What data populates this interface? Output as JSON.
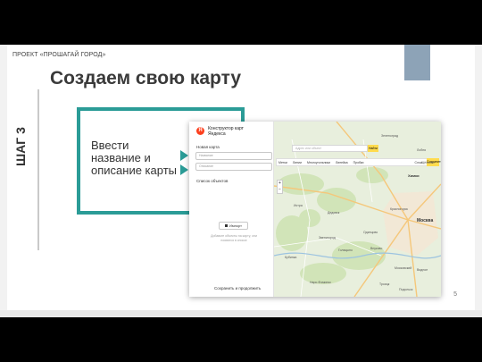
{
  "slide": {
    "project_label": "ПРОЕКТ «ПРОШАГАЙ ГОРОД»",
    "title": "Создаем свою карту",
    "step_label": "ШАГ 3",
    "instruction": "Ввести название и описание карты",
    "page_number": "5"
  },
  "constructor": {
    "brand_line1": "Конструктор карт",
    "brand_line2": "Яндекса",
    "logo_letter": "Я",
    "new_map_label": "Новая карта",
    "name_placeholder": "Название",
    "description_placeholder": "Описание",
    "objects_label": "Список объектов",
    "import_label": "Импорт",
    "hint_text": "Добавьте объекты на карту, они появятся в списке",
    "save_continue": "Сохранить и продолжить"
  },
  "map": {
    "search_placeholder": "Адрес или объект",
    "search_button": "Найти",
    "tools": [
      "Метки",
      "Линии",
      "Многоугольники",
      "Линейка",
      "Пробки",
      "Слои"
    ],
    "save_button": "Сохранить",
    "zoom_in": "+",
    "zoom_out": "−",
    "labels": {
      "zelenograd": "Зеленоград",
      "lobnya": "Лобня",
      "khimki": "Химки",
      "moskva": "Москва",
      "krasnogorsk": "Красногорск",
      "odintsovo": "Одинцово",
      "istra": "Истра",
      "dedovsk": "Дедовск",
      "shchelkovo": "Щёлково",
      "vidnoe": "Видное",
      "troitsk": "Троицк",
      "moskovsky": "Московский",
      "kubinka": "Кубинка",
      "zvenigorod": "Звенигород",
      "golitsyno": "Голицыно",
      "naro_fominsk": "Наро-Фоминск",
      "podolsk": "Подольск",
      "vnukovo": "Внуково"
    }
  },
  "colors": {
    "teal": "#2b9c97",
    "accent_box": "#8da3b7",
    "yandex_red": "#fc3f1d",
    "yandex_yellow": "#ffdb4d",
    "map_bg": "#e8efdd"
  }
}
